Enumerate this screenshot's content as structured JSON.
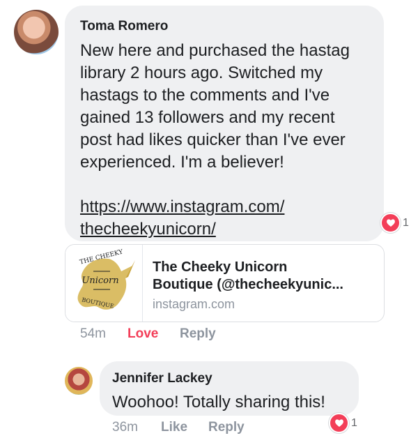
{
  "comment_1": {
    "author": "Toma Romero",
    "text": "New here and purchased the hastag\nlibrary 2 hours ago.  Switched my\nhastags to the comments and I've\ngained 13 followers and my recent\npost had likes quicker than I've ever\nexperienced.  I'm a believer!",
    "link": "https://www.instagram.com/\nthecheekyunicorn/",
    "reaction_count": "1",
    "time": "54m",
    "love_label": "Love",
    "reply_label": "Reply"
  },
  "link_preview": {
    "title_line_1": "The Cheeky Unicorn",
    "title_line_2": "Boutique (@thecheekyunic...",
    "domain": "instagram.com",
    "logo_top_text": "THE CHEEKY",
    "logo_middle_text": "Unicorn",
    "logo_bottom_text": "BOUTIQUE"
  },
  "comment_2": {
    "author": "Jennifer Lackey",
    "text": "Woohoo! Totally sharing this!",
    "reaction_count": "1",
    "time": "36m",
    "like_label": "Like",
    "reply_label": "Reply"
  },
  "icons": {
    "reaction": "heart-icon"
  },
  "colors": {
    "love": "#f33e58",
    "bubble": "#eff0f2",
    "meta": "#8d949e",
    "logo_gold": "#d4b24a"
  }
}
